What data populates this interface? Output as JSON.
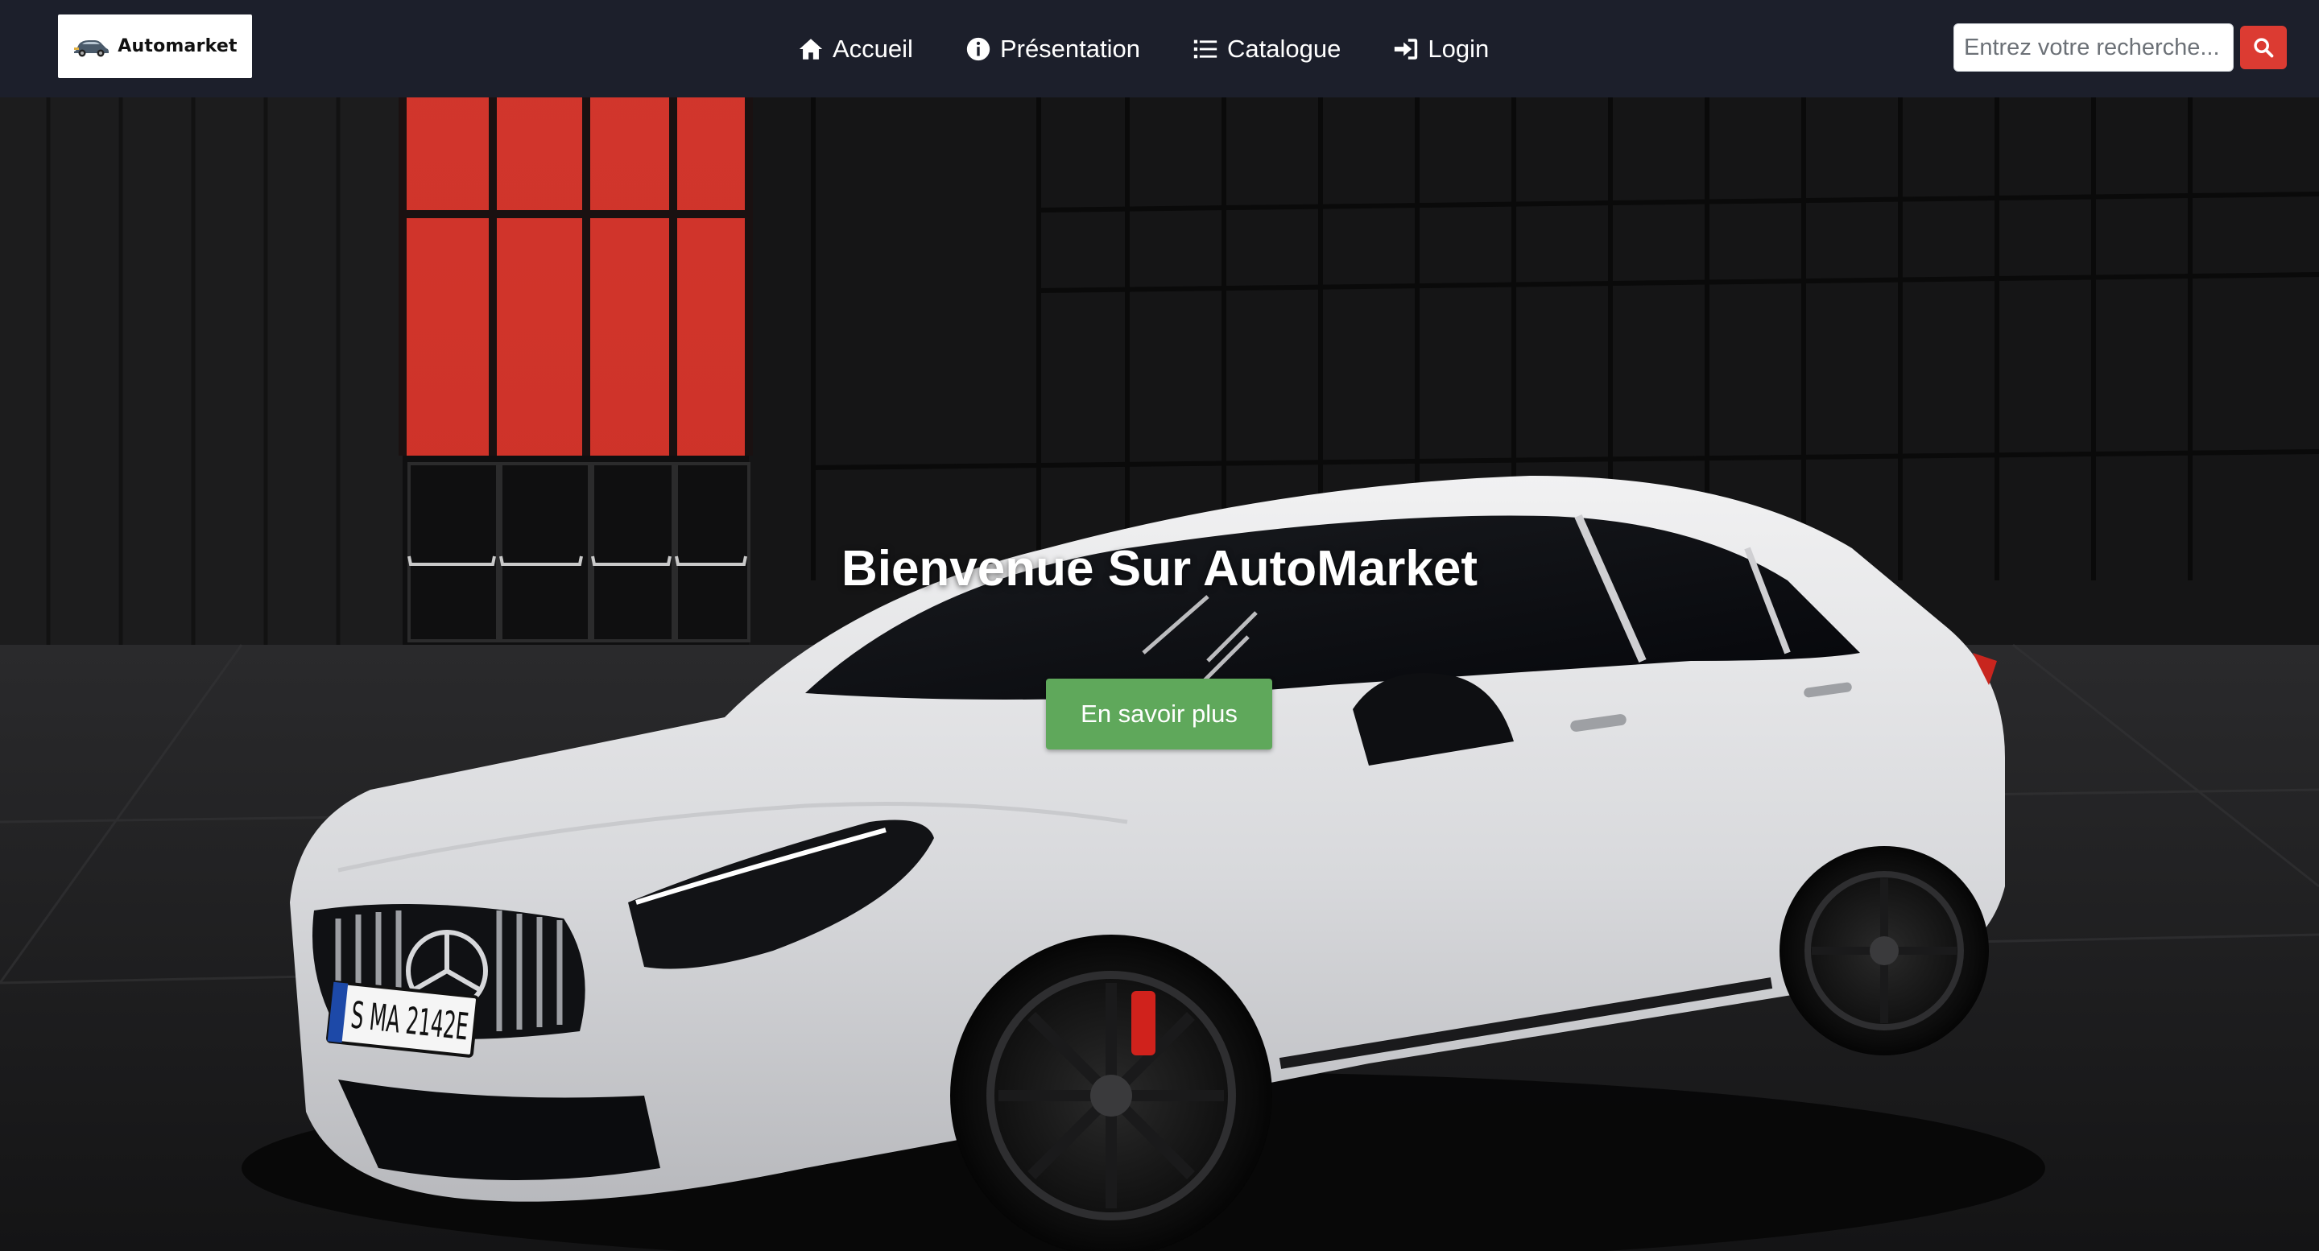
{
  "brand": {
    "name": "Automarket",
    "icon": "car-logo-icon"
  },
  "nav": {
    "items": [
      {
        "label": "Accueil",
        "icon": "home-icon"
      },
      {
        "label": "Présentation",
        "icon": "info-circle-icon"
      },
      {
        "label": "Catalogue",
        "icon": "list-icon"
      },
      {
        "label": "Login",
        "icon": "sign-in-icon"
      }
    ]
  },
  "search": {
    "placeholder": "Entrez votre recherche...",
    "button_icon": "search-icon"
  },
  "hero": {
    "title": "Bienvenue Sur AutoMarket",
    "cta_label": "En savoir plus",
    "plate_text": "S MA 2142E"
  },
  "colors": {
    "navbar_bg": "#1c1f2b",
    "search_button": "#dc3b32",
    "cta_button": "#5fa85b",
    "red_window": "#e8372c"
  }
}
